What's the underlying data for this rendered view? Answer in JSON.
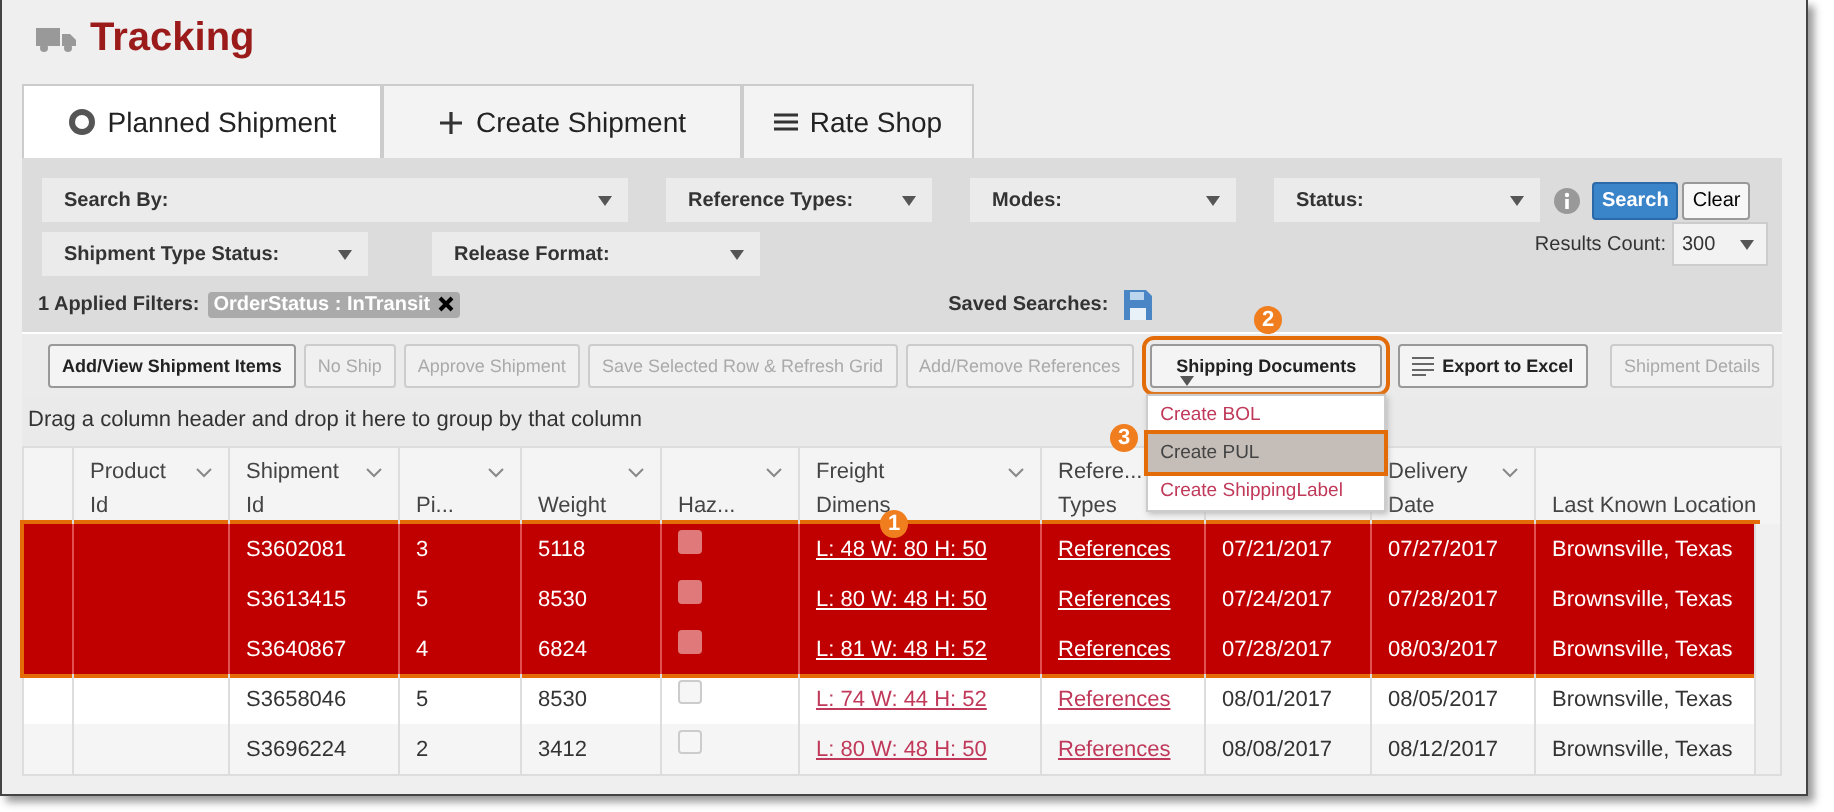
{
  "page": {
    "title": "Tracking"
  },
  "tabs": [
    {
      "label": "Planned Shipment",
      "selected": true
    },
    {
      "label": "Create Shipment",
      "selected": false
    },
    {
      "label": "Rate Shop",
      "selected": false
    }
  ],
  "filters": {
    "row_1": [
      {
        "label": "Search By:"
      },
      {
        "label": "Reference Types:"
      },
      {
        "label": "Modes:"
      },
      {
        "label": "Status:"
      }
    ],
    "row_2": [
      {
        "label": "Shipment Type Status:"
      },
      {
        "label": "Release Format:"
      }
    ],
    "search_button": "Search",
    "clear_button": "Clear",
    "results_count_label": "Results Count:",
    "results_count": "300",
    "applied_filters_label": "1 Applied Filters:",
    "applied_filters": [
      {
        "text": "OrderStatus : InTransit"
      }
    ],
    "saved_searches_label": "Saved Searches:"
  },
  "toolbar": [
    {
      "label": "Add/View Shipment Items",
      "kind": "button",
      "disabled": false,
      "highlighted": false
    },
    {
      "label": "No Ship",
      "kind": "button",
      "disabled": true,
      "highlighted": false
    },
    {
      "label": "Approve Shipment",
      "kind": "button",
      "disabled": true,
      "highlighted": false
    },
    {
      "label": "Save Selected Row & Refresh Grid",
      "kind": "button",
      "disabled": true,
      "highlighted": false
    },
    {
      "label": "Add/Remove References",
      "kind": "button",
      "disabled": true,
      "highlighted": false
    },
    {
      "label": "Shipping Documents",
      "kind": "dropdown",
      "disabled": false,
      "highlighted": true,
      "callout": "2",
      "menu": [
        {
          "label": "Create BOL",
          "highlighted": false
        },
        {
          "label": "Create PUL",
          "highlighted": true,
          "callout": "3"
        },
        {
          "label": "Create ShippingLabel",
          "highlighted": false
        }
      ]
    },
    {
      "label": "Export to Excel",
      "kind": "export",
      "disabled": false,
      "highlighted": false
    },
    {
      "label": "Shipment Details",
      "kind": "button",
      "disabled": true,
      "highlighted": false
    }
  ],
  "group_hint": "Drag a column header and drop it here to group by that column",
  "table": {
    "columns": [
      {
        "line_1": "Product",
        "line_2": "Id",
        "menu": true
      },
      {
        "line_1": "Shipment",
        "line_2": "Id",
        "menu": true
      },
      {
        "line_2": "Pi...",
        "menu": true
      },
      {
        "line_2": "Weight",
        "menu": true
      },
      {
        "line_2": "Haz...",
        "menu": true
      },
      {
        "line_1": "Freight",
        "line_2": "Dimens",
        "menu": true
      },
      {
        "line_1": "Refere...",
        "line_2": "Types"
      },
      {},
      {
        "line_1": "Delivery",
        "line_2": "Date",
        "menu": true
      },
      {
        "line_2": "Last Known Location",
        "menu": false
      }
    ],
    "rows": [
      {
        "selected": true,
        "shipment_id": "S3602081",
        "pieces": "3",
        "weight": "5118",
        "hazardous": false,
        "freight_dimensions": "L: 48 W: 80 H: 50",
        "reference_types": "References",
        "column_8": "07/21/2017",
        "delivery_date": "07/27/2017",
        "last_known_location": "Brownsville, Texas"
      },
      {
        "selected": true,
        "shipment_id": "S3613415",
        "pieces": "5",
        "weight": "8530",
        "hazardous": false,
        "freight_dimensions": "L: 80 W: 48 H: 50",
        "reference_types": "References",
        "column_8": "07/24/2017",
        "delivery_date": "07/28/2017",
        "last_known_location": "Brownsville, Texas"
      },
      {
        "selected": true,
        "shipment_id": "S3640867",
        "pieces": "4",
        "weight": "6824",
        "hazardous": false,
        "freight_dimensions": "L: 81 W: 48 H: 52",
        "reference_types": "References",
        "column_8": "07/28/2017",
        "delivery_date": "08/03/2017",
        "last_known_location": "Brownsville, Texas"
      },
      {
        "selected": false,
        "shipment_id": "S3658046",
        "pieces": "5",
        "weight": "8530",
        "hazardous": false,
        "freight_dimensions": "L: 74 W: 44 H: 52",
        "reference_types": "References",
        "column_8": "08/01/2017",
        "delivery_date": "08/05/2017",
        "last_known_location": "Brownsville, Texas"
      },
      {
        "selected": false,
        "shipment_id": "S3696224",
        "pieces": "2",
        "weight": "3412",
        "hazardous": false,
        "freight_dimensions": "L: 80 W: 48 H: 50",
        "reference_types": "References",
        "column_8": "08/08/2017",
        "delivery_date": "08/12/2017",
        "last_known_location": "Brownsville, Texas"
      }
    ],
    "selection_callout": "1"
  }
}
